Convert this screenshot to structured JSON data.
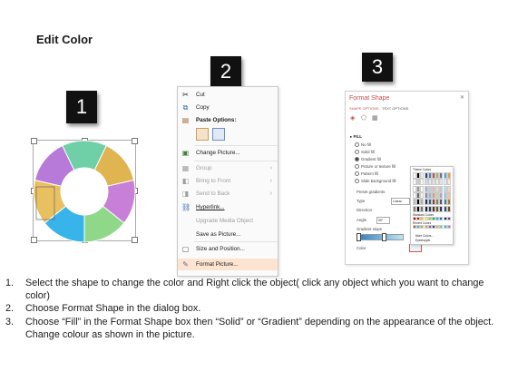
{
  "title": "Edit Color",
  "steps": [
    "1",
    "2",
    "3"
  ],
  "context_menu": {
    "items": [
      {
        "label": "Cut",
        "icon": "scissors-icon",
        "enabled": true
      },
      {
        "label": "Copy",
        "icon": "copy-icon",
        "enabled": true
      },
      {
        "label": "Paste Options:",
        "icon": "paste-icon",
        "enabled": true
      },
      {
        "label": "Change Picture...",
        "icon": "picture-icon",
        "enabled": true
      },
      {
        "label": "Group",
        "icon": "group-icon",
        "enabled": false,
        "submenu": true
      },
      {
        "label": "Bring to Front",
        "icon": "bring-front-icon",
        "enabled": false,
        "submenu": true
      },
      {
        "label": "Send to Back",
        "icon": "send-back-icon",
        "enabled": false,
        "submenu": true
      },
      {
        "label": "Hyperlink...",
        "icon": "hyperlink-icon",
        "enabled": true
      },
      {
        "label": "Upgrade Media Object",
        "icon": "",
        "enabled": false
      },
      {
        "label": "Save as Picture...",
        "icon": "save-icon",
        "enabled": true
      },
      {
        "label": "Size and Position...",
        "icon": "size-icon",
        "enabled": true
      },
      {
        "label": "Format Picture...",
        "icon": "format-icon",
        "enabled": true,
        "highlighted": true
      }
    ]
  },
  "format_panel": {
    "title": "Format Shape",
    "tabs": [
      "SHAPE OPTIONS",
      "TEXT OPTIONS"
    ],
    "section": "FILL",
    "options": [
      "No fill",
      "Solid fill",
      "Gradient fill",
      "Picture or texture fill",
      "Pattern fill",
      "Slide background fill"
    ],
    "selected_option": "Gradient fill",
    "fields": [
      {
        "label": "Preset gradients",
        "value": ""
      },
      {
        "label": "Type",
        "value": "Linear"
      },
      {
        "label": "Direction",
        "value": ""
      },
      {
        "label": "Angle",
        "value": "90°"
      },
      {
        "label": "Gradient stops",
        "value": ""
      },
      {
        "label": "Color",
        "value": ""
      }
    ],
    "palette": {
      "theme_label": "Theme Colors",
      "standard_label": "Standard Colors",
      "recent_label": "Recent Colors",
      "more_label": "More Colors...",
      "eyedropper_label": "Eyedropper"
    }
  },
  "instructions": [
    {
      "num": "1.",
      "text": "Select the shape to change the color and Right click the object( click any object which you want to change color)"
    },
    {
      "num": "2.",
      "text": "Choose Format Shape in the dialog box."
    },
    {
      "num": "3.",
      "text": "Choose “Fill” in the Format Shape box then “Solid” or “Gradient” depending on the appearance of the object. Change colour as shown in the picture."
    }
  ],
  "colors": {
    "donut_segments": [
      "#6fd0a8",
      "#e0b450",
      "#c87fd8",
      "#8fd88a",
      "#37b4ea",
      "#e8c060",
      "#b77ad8"
    ],
    "badge": "#111111",
    "accent": "#c0504d"
  }
}
